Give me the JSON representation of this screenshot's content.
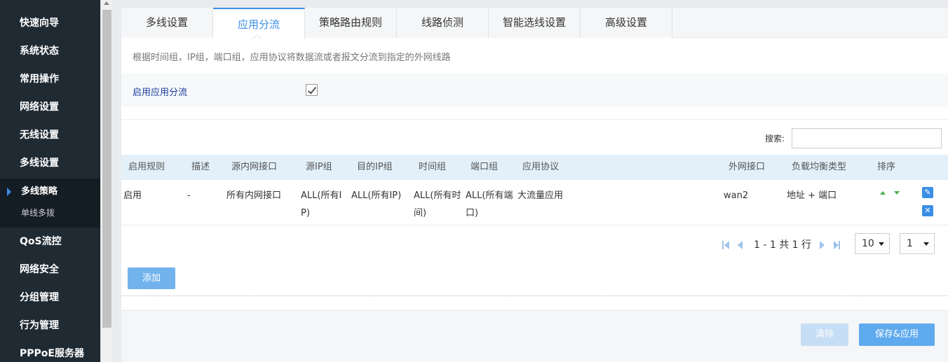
{
  "sidebar": {
    "items_top": [
      "快速向导",
      "系统状态",
      "常用操作",
      "网络设置",
      "无线设置",
      "多线设置"
    ],
    "sub_items": [
      "多线策略",
      "单线多拨"
    ],
    "items_bottom": [
      "QoS流控",
      "网络安全",
      "分组管理",
      "行为管理",
      "PPPoE服务器"
    ]
  },
  "tabs": [
    "多线设置",
    "应用分流",
    "策略路由规则",
    "线路侦测",
    "智能选线设置",
    "高级设置"
  ],
  "description": "根据时间组，IP组，端口组，应用协议将数据流或者报文分流到指定的外网线路",
  "enable": {
    "label": "启用应用分流",
    "checked": true
  },
  "search": {
    "label": "搜索:",
    "value": ""
  },
  "table": {
    "headers": [
      "启用规则",
      "描述",
      "源内网接口",
      "源IP组",
      "目的IP组",
      "时间组",
      "端口组",
      "应用协议",
      "外网接口",
      "负载均衡类型",
      "排序"
    ],
    "row": {
      "enabled": "启用",
      "desc": "-",
      "src_iface": "所有内网接口",
      "src_ip_l1": "ALL(所有I",
      "src_ip_l2": "P)",
      "dst_ip": "ALL(所有IP)",
      "time_l1": "ALL(所有时",
      "time_l2": "间)",
      "port_l1": "ALL(所有端",
      "port_l2": "口)",
      "protocol": "大流量应用",
      "wan": "wan2",
      "lb_type": "地址 + 端口"
    }
  },
  "pager": {
    "text": "1 - 1 共 1 行",
    "page_size": "10",
    "page": "1"
  },
  "buttons": {
    "add": "添加",
    "clear": "清除",
    "save": "保存&应用"
  },
  "icons": {
    "edit": "✎",
    "delete": "✕"
  }
}
